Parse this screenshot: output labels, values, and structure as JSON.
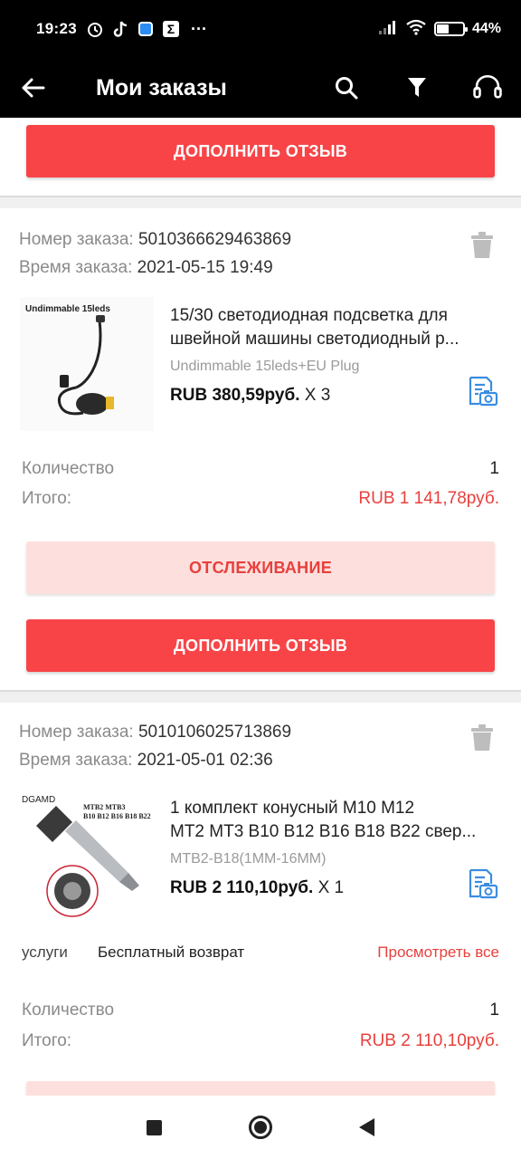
{
  "status_bar": {
    "time": "19:23",
    "left_icons": [
      "alarm-icon",
      "tiktok-icon",
      "app-icon",
      "sigma-icon"
    ],
    "more": "···",
    "battery_percent": "44%",
    "battery_level": 0.44
  },
  "app_bar": {
    "title": "Мои заказы",
    "back_icon": "arrow-left-icon",
    "actions": [
      "search-icon",
      "filter-icon",
      "headset-icon"
    ]
  },
  "orders": [
    {
      "review_button": "ДОПОЛНИТЬ ОТЗЫВ"
    },
    {
      "number_label": "Номер заказа:",
      "number": "5010366629463869",
      "time_label": "Время заказа:",
      "time": "2021-05-15 19:49",
      "thumb_caption": "Undimmable 15leds",
      "title_line1": "15/30 светодиодная подсветка для",
      "title_line2": "швейной машины светодиодный р...",
      "variant": "Undimmable 15leds+EU Plug",
      "price": "RUB 380,59руб.",
      "qty_mult": "X 3",
      "qty_label": "Количество",
      "qty": "1",
      "total_label": "Итого:",
      "total": "RUB 1 141,78руб.",
      "track_button": "ОТСЛЕЖИВАНИЕ",
      "review_button": "ДОПОЛНИТЬ ОТЗЫВ"
    },
    {
      "number_label": "Номер заказа:",
      "number": "5010106025713869",
      "time_label": "Время заказа:",
      "time": "2021-05-01 02:36",
      "thumb_brand": "DGAMD",
      "thumb_text1": "MTB2 MTB3",
      "thumb_text2": "B10 B12 B16 B18 B22",
      "title_line1": "1 комплект конусный M10 M12",
      "title_line2": "MT2 MT3 B10 B12 B16 B18 B22 свер...",
      "variant": "MTB2-B18(1MM-16MM)",
      "price": "RUB 2 110,10руб.",
      "qty_mult": "X 1",
      "service_label": "услуги",
      "service_value": "Бесплатный возврат",
      "service_link": "Просмотреть все",
      "qty_label": "Количество",
      "qty": "1",
      "total_label": "Итого:",
      "total": "RUB 2 110,10руб."
    }
  ],
  "colors": {
    "accent": "#f84447",
    "accent_soft": "#fde0de",
    "accent_text": "#e8403c",
    "link_blue": "#3a8de0"
  },
  "nav_bar": [
    "recents-button",
    "home-button",
    "back-button"
  ]
}
